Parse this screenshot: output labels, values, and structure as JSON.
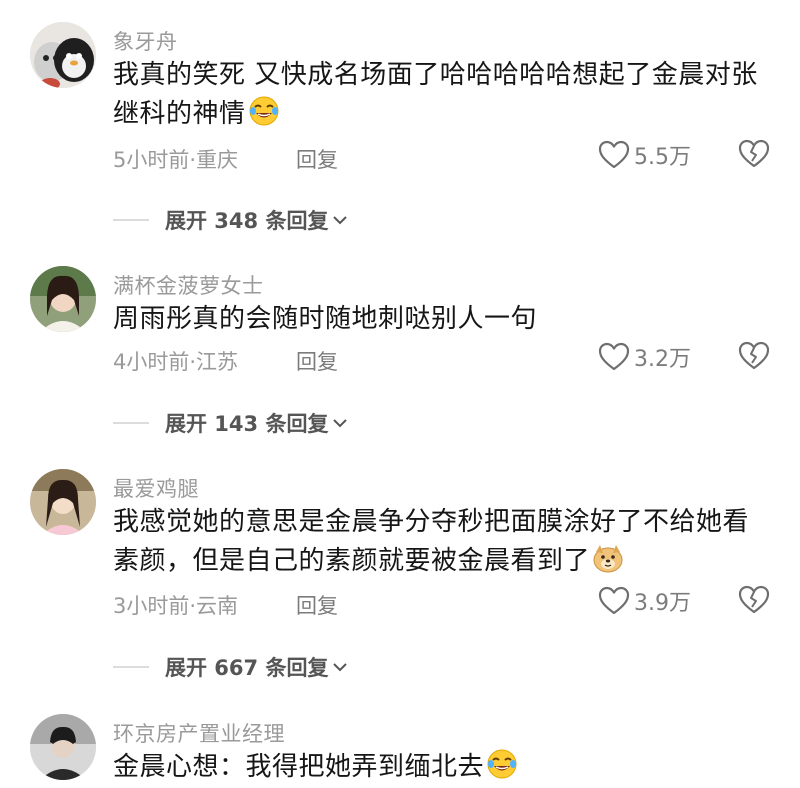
{
  "comments": [
    {
      "username": "象牙舟",
      "text": "我真的笑死 又快成名场面了哈哈哈哈哈想起了金晨对张继科的神情",
      "emoji": "laughing-tears-emoji",
      "time_location": "5小时前·重庆",
      "reply_label": "回复",
      "likes": "5.5万",
      "expand_label": "展开 348 条回复"
    },
    {
      "username": "满杯金菠萝女士",
      "text": "周雨彤真的会随时随地刺哒别人一句",
      "time_location": "4小时前·江苏",
      "reply_label": "回复",
      "likes": "3.2万",
      "expand_label": "展开 143 条回复"
    },
    {
      "username": "最爱鸡腿",
      "text": "我感觉她的意思是金晨争分夺秒把面膜涂好了不给她看素颜，但是自己的素颜就要被金晨看到了",
      "emoji": "doge-emoji",
      "time_location": "3小时前·云南",
      "reply_label": "回复",
      "likes": "3.9万",
      "expand_label": "展开 667 条回复"
    },
    {
      "username": "环京房产置业经理",
      "text": "金晨心想：我得把她弄到缅北去",
      "emoji": "laughing-tears-emoji"
    }
  ],
  "colors": {
    "username": "#9a9a9a",
    "body_text": "#161616",
    "meta": "#9a9a9a",
    "expand_text": "#555555"
  }
}
